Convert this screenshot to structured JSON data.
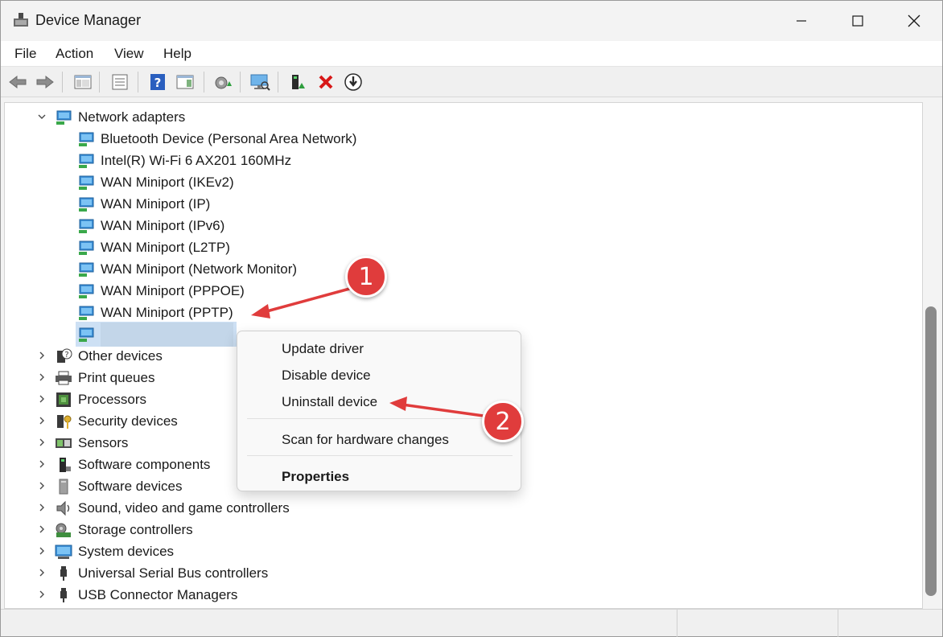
{
  "window": {
    "title": "Device Manager"
  },
  "menu": {
    "items": [
      "File",
      "Action",
      "View",
      "Help"
    ]
  },
  "toolbar": {
    "icons": [
      "back-arrow-icon",
      "forward-arrow-icon",
      "show-hide-console-tree-icon",
      "properties-icon",
      "help-icon",
      "action-pane-icon",
      "update-driver-icon",
      "scan-hardware-icon",
      "enable-device-icon",
      "uninstall-device-icon",
      "disable-device-icon"
    ]
  },
  "tree": {
    "expanded_category": "Network adapters",
    "adapters": [
      "Bluetooth Device (Personal Area Network)",
      "Intel(R) Wi-Fi 6 AX201 160MHz",
      "WAN Miniport (IKEv2)",
      "WAN Miniport (IP)",
      "WAN Miniport (IPv6)",
      "WAN Miniport (L2TP)",
      "WAN Miniport (Network Monitor)",
      "WAN Miniport (PPPOE)",
      "WAN Miniport (PPTP)"
    ],
    "categories": [
      "Other devices",
      "Print queues",
      "Processors",
      "Security devices",
      "Sensors",
      "Software components",
      "Software devices",
      "Sound, video and game controllers",
      "Storage controllers",
      "System devices",
      "Universal Serial Bus controllers",
      "USB Connector Managers"
    ]
  },
  "context_menu": {
    "update_driver": "Update driver",
    "disable_device": "Disable device",
    "uninstall_device": "Uninstall device",
    "scan_hardware": "Scan for hardware changes",
    "properties": "Properties"
  },
  "annotations": {
    "step1": "1",
    "step2": "2",
    "color": "#e03c3c"
  }
}
